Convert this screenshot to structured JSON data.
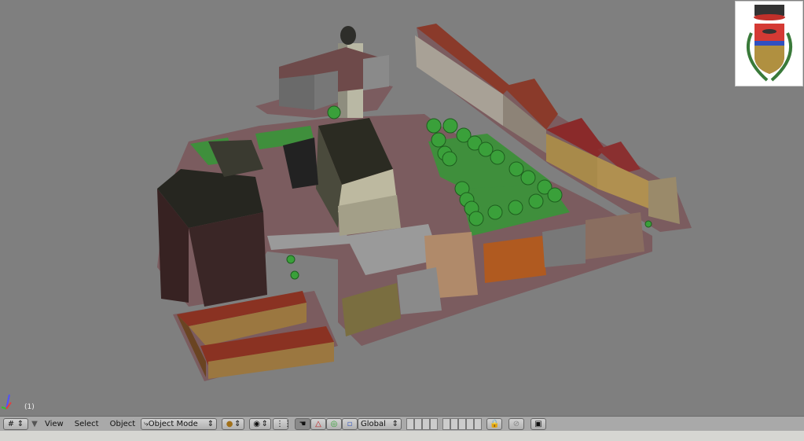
{
  "viewport": {
    "frame_label": "(1)",
    "background": "#7f7f7f"
  },
  "toolbar": {
    "editor_type_icon": "grid-icon",
    "menus": [
      "View",
      "Select",
      "Object"
    ],
    "mode": "Object Mode",
    "draw_type_icon": "solid-sphere-icon",
    "pivot_icon": "pivot-icon",
    "manipulator_icons": [
      "hand-icon",
      "translate-icon",
      "rotate-icon",
      "scale-icon"
    ],
    "orientation": "Global",
    "layer_lock_icon": "lock-icon",
    "render_icon": "image-icon"
  },
  "logo": {
    "description_text": "Municipal coat of arms"
  }
}
